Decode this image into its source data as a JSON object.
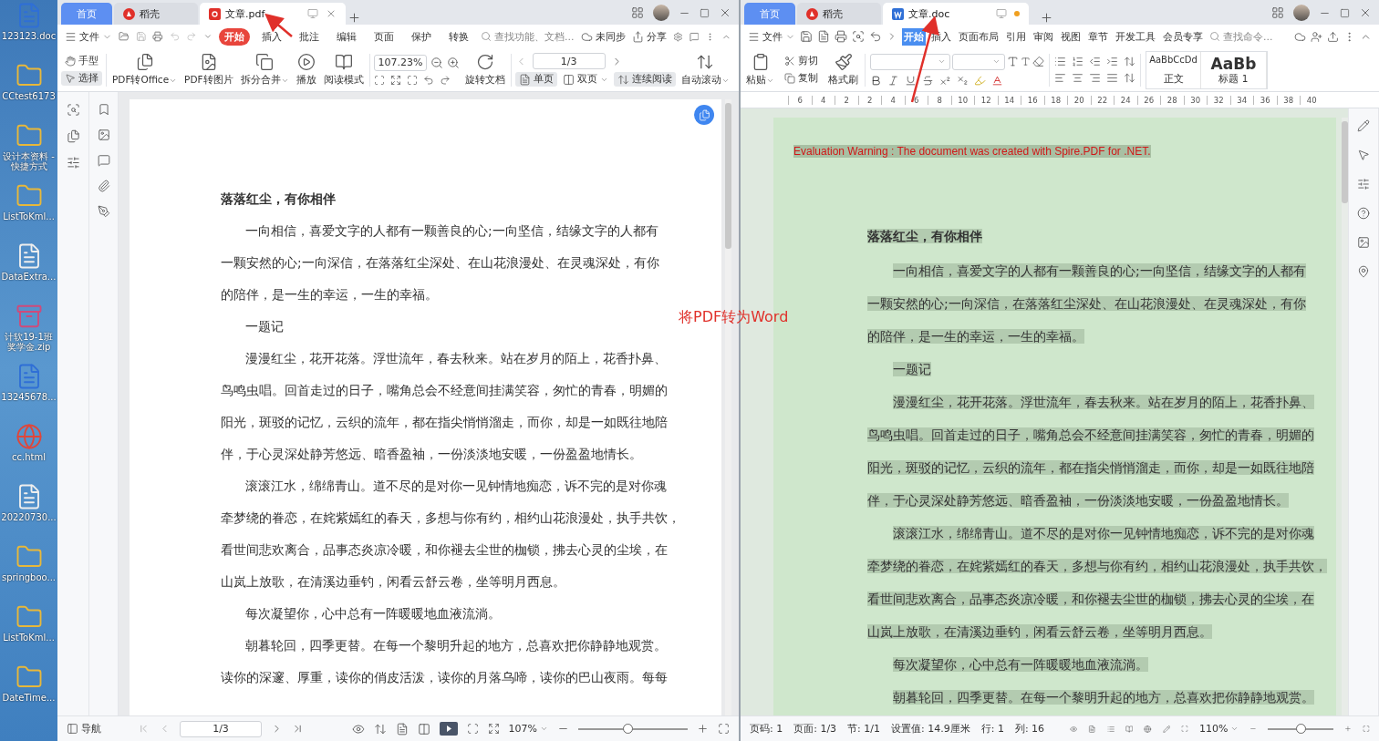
{
  "desktop_icons": [
    {
      "label": "123123.doc",
      "kind": "word"
    },
    {
      "label": "CCtest6173",
      "kind": "folder"
    },
    {
      "label": "设计本资料 - 快捷方式",
      "kind": "folder"
    },
    {
      "label": "ListToKml...",
      "kind": "folder"
    },
    {
      "label": "DataExtra...",
      "kind": "text"
    },
    {
      "label": "计软19-1班奖学金.zip",
      "kind": "zip"
    },
    {
      "label": "13245678...",
      "kind": "word"
    },
    {
      "label": "cc.html",
      "kind": "browser"
    },
    {
      "label": "20220730...",
      "kind": "text"
    },
    {
      "label": "springboo...",
      "kind": "folder"
    },
    {
      "label": "ListToKml...",
      "kind": "folder"
    },
    {
      "label": "DateTime...",
      "kind": "folder"
    }
  ],
  "pdf_window": {
    "tabs": [
      {
        "label": "首页",
        "kind": "home",
        "selected": false
      },
      {
        "label": "稻壳",
        "kind": "docer",
        "selected": false
      },
      {
        "label": "文章.pdf",
        "kind": "pdf",
        "selected": true,
        "modified": false
      }
    ],
    "file_menu": "文件",
    "menu_tabs": [
      {
        "label": "开始",
        "selected": true
      },
      {
        "label": "插入",
        "selected": false
      },
      {
        "label": "批注",
        "selected": false
      },
      {
        "label": "编辑",
        "selected": false
      },
      {
        "label": "页面",
        "selected": false
      },
      {
        "label": "保护",
        "selected": false
      },
      {
        "label": "转换",
        "selected": false
      }
    ],
    "search": {
      "placeholder": "查找功能、文档..."
    },
    "sync": "未同步",
    "share": "分享",
    "hand_tools": [
      {
        "label": "手型",
        "kind": "hand",
        "selected": false
      },
      {
        "label": "选择",
        "kind": "select",
        "selected": true
      }
    ],
    "tools": [
      {
        "label": "PDF转Office",
        "kind": "convert",
        "dropdown": true
      },
      {
        "label": "PDF转图片",
        "kind": "image",
        "dropdown": false
      },
      {
        "label": "拆分合并",
        "kind": "split",
        "dropdown": true
      },
      {
        "label": "播放",
        "kind": "play",
        "dropdown": false
      },
      {
        "label": "阅读模式",
        "kind": "read",
        "dropdown": false
      }
    ],
    "zoom": "107.23%",
    "rotate_tool": "旋转文档",
    "page_field": "1/3",
    "view_modes": [
      {
        "label": "单页",
        "kind": "single",
        "selected": true,
        "dropdown": false
      },
      {
        "label": "双页",
        "kind": "double",
        "selected": false,
        "dropdown": true
      },
      {
        "label": "连续阅读",
        "kind": "continuous",
        "selected": true,
        "dropdown": false
      }
    ],
    "auto_scroll": "自动滚动",
    "document": {
      "title": "落落红尘，有你相伴",
      "paragraphs": [
        {
          "lines": [
            "一向相信，喜爱文字的人都有一颗善良的心;一向坚信，结缘文字的人都有",
            "一颗安然的心;一向深信，在落落红尘深处、在山花浪漫处、在灵魂深处，有你",
            "的陪伴，是一生的幸运，一生的幸福。"
          ]
        },
        {
          "lines": [
            "一题记"
          ]
        },
        {
          "lines": [
            "漫漫红尘，花开花落。浮世流年，春去秋来。站在岁月的陌上，花香扑鼻、",
            "鸟鸣虫唱。回首走过的日子，嘴角总会不经意间挂满笑容，匆忙的青春，明媚的",
            "阳光，斑驳的记忆，云织的流年，都在指尖悄悄溜走，而你，却是一如既往地陪",
            "伴，于心灵深处静芳悠远、暗香盈袖，一份淡淡地安暖，一份盈盈地情长。"
          ]
        },
        {
          "lines": [
            "滚滚江水，绵绵青山。道不尽的是对你一见钟情地痴恋，诉不完的是对你魂",
            "牵梦绕的眷恋，在姹紫嫣红的春天，多想与你有约，相约山花浪漫处，执手共饮，",
            "看世间悲欢离合，品事态炎凉冷暖，和你褪去尘世的枷锁，拂去心灵的尘埃，在",
            "山岚上放歌，在清溪边垂钓，闲看云舒云卷，坐等明月西息。"
          ]
        },
        {
          "lines": [
            "每次凝望你，心中总有一阵暖暖地血液流淌。"
          ]
        },
        {
          "lines": [
            "朝暮轮回，四季更替。在每一个黎明升起的地方，总喜欢把你静静地观赏。",
            "读你的深邃、厚重，读你的俏皮活泼，读你的月落乌啼，读你的巴山夜雨。每每"
          ]
        }
      ]
    },
    "status": {
      "navigation": "导航",
      "page_field": "1/3",
      "zoom": "107%",
      "slider": {
        "level": 0.45
      }
    }
  },
  "word_window": {
    "tabs": [
      {
        "label": "首页",
        "kind": "home",
        "selected": false
      },
      {
        "label": "稻壳",
        "kind": "docer",
        "selected": false
      },
      {
        "label": "文章.doc",
        "kind": "word",
        "selected": true,
        "modified": true
      }
    ],
    "file_menu": "文件",
    "menu_tabs": [
      {
        "label": "开始",
        "selected": true
      },
      {
        "label": "插入",
        "selected": false
      },
      {
        "label": "页面布局",
        "selected": false
      },
      {
        "label": "引用",
        "selected": false
      },
      {
        "label": "审阅",
        "selected": false
      },
      {
        "label": "视图",
        "selected": false
      },
      {
        "label": "章节",
        "selected": false
      },
      {
        "label": "开发工具",
        "selected": false
      },
      {
        "label": "会员专享",
        "selected": false
      }
    ],
    "search": {
      "placeholder": "查找命令..."
    },
    "clipboard": {
      "paste": "粘贴",
      "cut": "剪切",
      "copy": "复制",
      "format_painter": "格式刷"
    },
    "styles": [
      {
        "preview": "AaBbCcDd",
        "name": "正文",
        "kind": "body"
      },
      {
        "preview": "AaBb",
        "name": "标题 1",
        "kind": "heading"
      }
    ],
    "ruler": [
      "6",
      "4",
      "2",
      "2",
      "4",
      "6",
      "8",
      "10",
      "12",
      "14",
      "16",
      "18",
      "20",
      "22",
      "24",
      "26",
      "28",
      "30",
      "32",
      "34",
      "36",
      "38",
      "40"
    ],
    "warning": "Evaluation Warning : The document was created with Spire.PDF for .NET.",
    "document": {
      "title": "落落红尘，有你相伴",
      "paragraphs": [
        {
          "lines": [
            "一向相信，喜爱文字的人都有一颗善良的心;一向坚信，结缘文字的人都有",
            "一颗安然的心;一向深信，在落落红尘深处、在山花浪漫处、在灵魂深处，有你",
            "的陪伴，是一生的幸运，一生的幸福。"
          ]
        },
        {
          "lines": [
            "一题记"
          ]
        },
        {
          "lines": [
            "漫漫红尘，花开花落。浮世流年，春去秋来。站在岁月的陌上，花香扑鼻、",
            "鸟鸣虫唱。回首走过的日子，嘴角总会不经意间挂满笑容，匆忙的青春，明媚的",
            "阳光，斑驳的记忆，云织的流年，都在指尖悄悄溜走，而你，却是一如既往地陪",
            "伴，于心灵深处静芳悠远、暗香盈袖，一份淡淡地安暖，一份盈盈地情长。"
          ]
        },
        {
          "lines": [
            "滚滚江水，绵绵青山。道不尽的是对你一见钟情地痴恋，诉不完的是对你魂",
            "牵梦绕的眷恋，在姹紫嫣红的春天，多想与你有约，相约山花浪漫处，执手共饮，",
            "看世间悲欢离合，品事态炎凉冷暖，和你褪去尘世的枷锁，拂去心灵的尘埃，在",
            "山岚上放歌，在清溪边垂钓，闲看云舒云卷，坐等明月西息。"
          ]
        },
        {
          "lines": [
            "每次凝望你，心中总有一阵暖暖地血液流淌。"
          ]
        },
        {
          "lines": [
            "朝暮轮回，四季更替。在每一个黎明升起的地方，总喜欢把你静静地观赏。"
          ]
        }
      ]
    },
    "status": {
      "items": [
        "页码: 1",
        "页面: 1/3",
        "节: 1/1",
        "设置值: 14.9厘米",
        "行: 1",
        "列: 16"
      ],
      "zoom": "110%",
      "slider": {
        "level": 0.5
      }
    }
  },
  "annotation": "将PDF转为Word"
}
